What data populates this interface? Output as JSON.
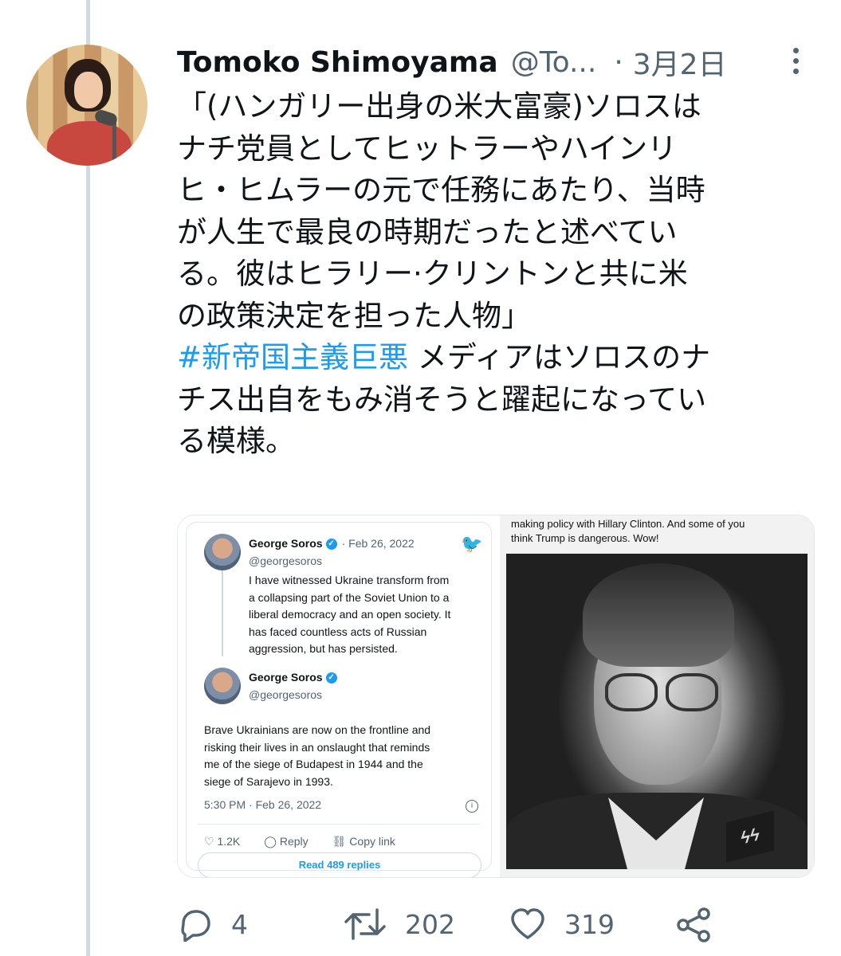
{
  "tweet": {
    "author_name": "Tomoko Shimoyama",
    "author_handle": "@To...",
    "separator": "·",
    "date": "3月2日",
    "text_lines": [
      "「(ハンガリー出身の米大富豪)ソロスは",
      "ナチ党員としてヒットラーやハインリ",
      "ヒ・ヒムラーの元で任務にあたり、当時",
      "が人生で最良の時期だったと述べてい",
      "る。彼はヒラリー·クリントンと共に米",
      "の政策決定を担った人物」"
    ],
    "hashtag": "#新帝国主義巨悪",
    "after_hashtag": " メディアはソロスのナ",
    "text_lines_2": [
      "チス出自をもみ消そうと躍起になってい",
      "る模様。"
    ],
    "counts": {
      "replies": "4",
      "retweets": "202",
      "likes": "319"
    }
  },
  "embedded_card": {
    "tweet1": {
      "name": "George Soros",
      "date": "· Feb 26, 2022",
      "handle": "@georgesoros",
      "text": "I have witnessed Ukraine transform from\na collapsing part of the Soviet Union to a\nliberal democracy and an open society. It\nhas faced countless acts of Russian\naggression, but has persisted."
    },
    "tweet2": {
      "name": "George Soros",
      "handle": "@georgesoros",
      "text": "Brave Ukrainians are now on the frontline and\nrisking their lives in an onslaught that reminds\nme of the siege of Budapest in 1944 and the\nsiege of Sarajevo in 1993.",
      "time": "5:30 PM · Feb 26, 2022",
      "likes": "1.2K",
      "reply_label": "Reply",
      "copy_label": "Copy link",
      "read_replies": "Read 489 replies"
    }
  },
  "photo_caption": "making policy with Hillary Clinton. And some of you\nthink Trump is dangerous. Wow!",
  "photo_insignia": "ϟϟ",
  "colors": {
    "accent": "#1d9bf0",
    "secondary_text": "#536471",
    "thread_line": "#cfd9de"
  },
  "icons": [
    "reply-icon",
    "retweet-icon",
    "like-icon",
    "share-icon",
    "more-icon",
    "twitter-bird-icon",
    "verified-badge-icon",
    "info-icon"
  ]
}
